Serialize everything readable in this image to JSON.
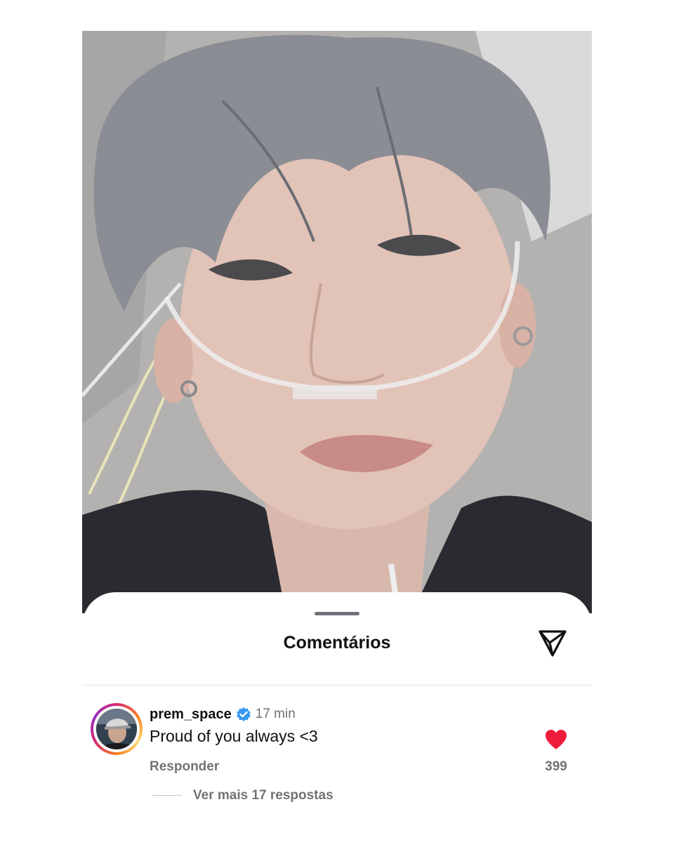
{
  "sheet": {
    "title": "Comentários",
    "filter_icon": "paper-plane-icon"
  },
  "comment": {
    "username": "prem_space",
    "verified_icon": "verified-badge-icon",
    "time": "17 min",
    "text": "Proud of you always <3",
    "reply_label": "Responder",
    "like_icon": "heart-filled-icon",
    "like_color": "#ed1c3a",
    "like_count": "399",
    "view_more_replies": "Ver mais 17 respostas"
  },
  "colors": {
    "verified": "#3897f0",
    "muted_text": "#737373",
    "primary_text": "#111111"
  }
}
